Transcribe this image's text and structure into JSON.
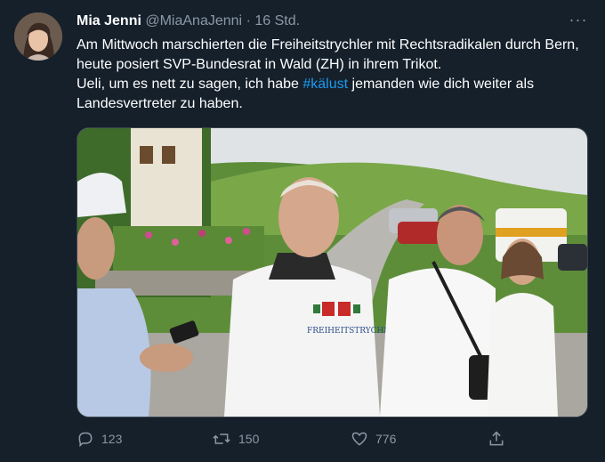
{
  "tweet": {
    "author_name": "Mia Jenni",
    "handle": "@MiaAnaJenni",
    "separator": "·",
    "time": "16 Std.",
    "text_part1": "Am Mittwoch marschierten die Freiheitstrychler mit Rechtsradikalen durch Bern, heute posiert SVP-Bundesrat in Wald (ZH) in ihrem Trikot.",
    "text_part2_before": "Ueli, um es nett zu sagen, ich habe ",
    "hashtag": "#kälust",
    "text_part2_after": " jemanden wie dich weiter als Landesvertreter zu haben.",
    "more_label": "···",
    "shirt_text": "FREIHEITSTRYCHLER"
  },
  "actions": {
    "reply_count": "123",
    "retweet_count": "150",
    "like_count": "776"
  },
  "icons": {
    "reply": "reply-icon",
    "retweet": "retweet-icon",
    "like": "heart-icon",
    "share": "share-icon",
    "more": "more-icon"
  },
  "colors": {
    "background": "#15202b",
    "text": "#ffffff",
    "secondary_text": "#8b98a5",
    "link": "#1d9bf0"
  }
}
